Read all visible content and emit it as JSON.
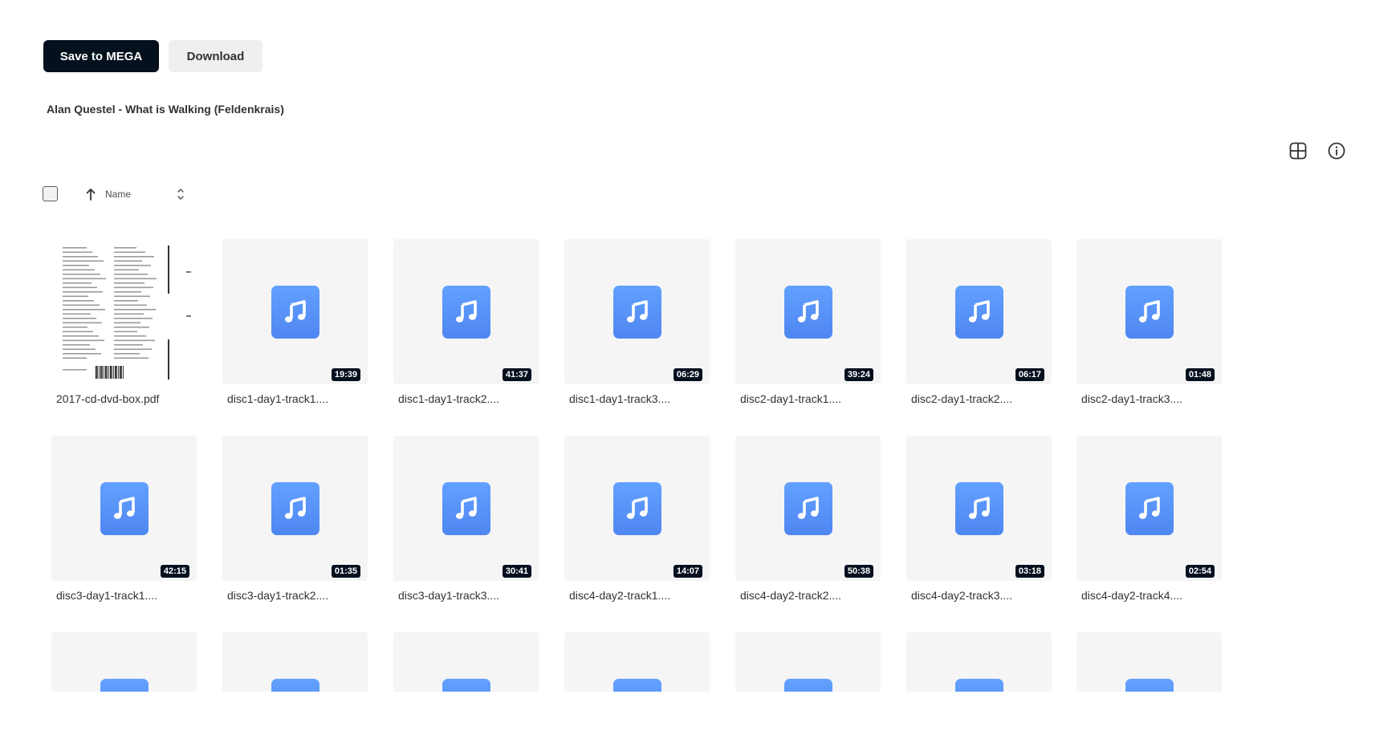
{
  "toolbar": {
    "save_label": "Save to MEGA",
    "download_label": "Download"
  },
  "folder": {
    "title": "Alan Questel - What is Walking (Feldenkrais)"
  },
  "sort": {
    "label": "Name",
    "direction": "ascending"
  },
  "view": {
    "mode_icon": "grid-view-icon",
    "info_icon": "info-icon"
  },
  "colors": {
    "primary_button": "#04101e",
    "secondary_button": "#efefef",
    "music_tile": "#5890f8",
    "duration_badge": "#04101e"
  },
  "files": [
    {
      "name": "2017-cd-dvd-box.pdf",
      "type": "pdf",
      "duration": ""
    },
    {
      "name": "disc1-day1-track1....",
      "type": "audio",
      "duration": "19:39"
    },
    {
      "name": "disc1-day1-track2....",
      "type": "audio",
      "duration": "41:37"
    },
    {
      "name": "disc1-day1-track3....",
      "type": "audio",
      "duration": "06:29"
    },
    {
      "name": "disc2-day1-track1....",
      "type": "audio",
      "duration": "39:24"
    },
    {
      "name": "disc2-day1-track2....",
      "type": "audio",
      "duration": "06:17"
    },
    {
      "name": "disc2-day1-track3....",
      "type": "audio",
      "duration": "01:48"
    },
    {
      "name": "disc3-day1-track1....",
      "type": "audio",
      "duration": "42:15"
    },
    {
      "name": "disc3-day1-track2....",
      "type": "audio",
      "duration": "01:35"
    },
    {
      "name": "disc3-day1-track3....",
      "type": "audio",
      "duration": "30:41"
    },
    {
      "name": "disc4-day2-track1....",
      "type": "audio",
      "duration": "14:07"
    },
    {
      "name": "disc4-day2-track2....",
      "type": "audio",
      "duration": "50:38"
    },
    {
      "name": "disc4-day2-track3....",
      "type": "audio",
      "duration": "03:18"
    },
    {
      "name": "disc4-day2-track4....",
      "type": "audio",
      "duration": "02:54"
    },
    {
      "name": "",
      "type": "audio",
      "duration": ""
    },
    {
      "name": "",
      "type": "audio",
      "duration": ""
    },
    {
      "name": "",
      "type": "audio",
      "duration": ""
    },
    {
      "name": "",
      "type": "audio",
      "duration": ""
    },
    {
      "name": "",
      "type": "audio",
      "duration": ""
    },
    {
      "name": "",
      "type": "audio",
      "duration": ""
    },
    {
      "name": "",
      "type": "audio",
      "duration": ""
    }
  ]
}
